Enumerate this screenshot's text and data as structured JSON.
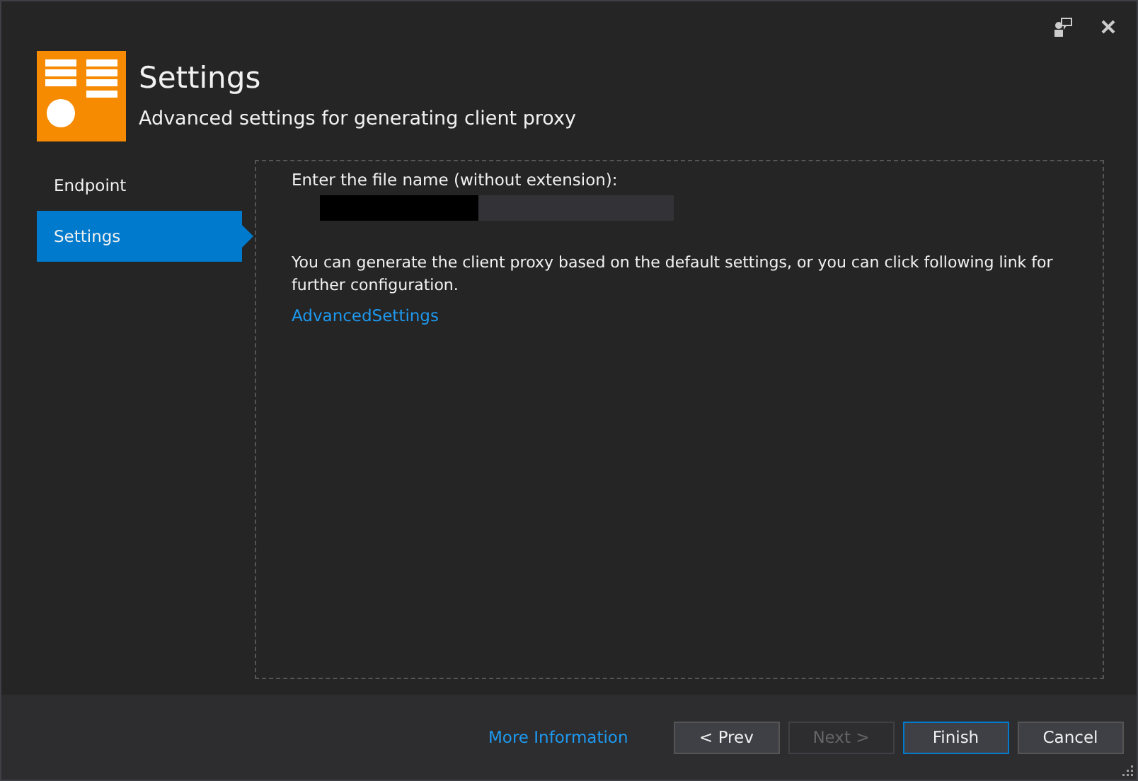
{
  "header": {
    "title": "Settings",
    "subtitle": "Advanced settings for generating client proxy"
  },
  "sidebar": {
    "items": [
      {
        "label": "Endpoint",
        "selected": false
      },
      {
        "label": "Settings",
        "selected": true
      }
    ]
  },
  "content": {
    "file_name_label": "Enter the file name (without extension):",
    "file_name_redacted": true,
    "description": "You can generate the client proxy based on the default settings, or you can click following link for further configuration.",
    "link": "AdvancedSettings"
  },
  "footer": {
    "link": "More Information",
    "buttons": [
      {
        "label": "< Prev",
        "disabled": false,
        "default": false
      },
      {
        "label": "Next >",
        "disabled": true,
        "default": false
      },
      {
        "label": "Finish",
        "disabled": false,
        "default": true
      },
      {
        "label": "Cancel",
        "disabled": false,
        "default": false
      }
    ]
  }
}
